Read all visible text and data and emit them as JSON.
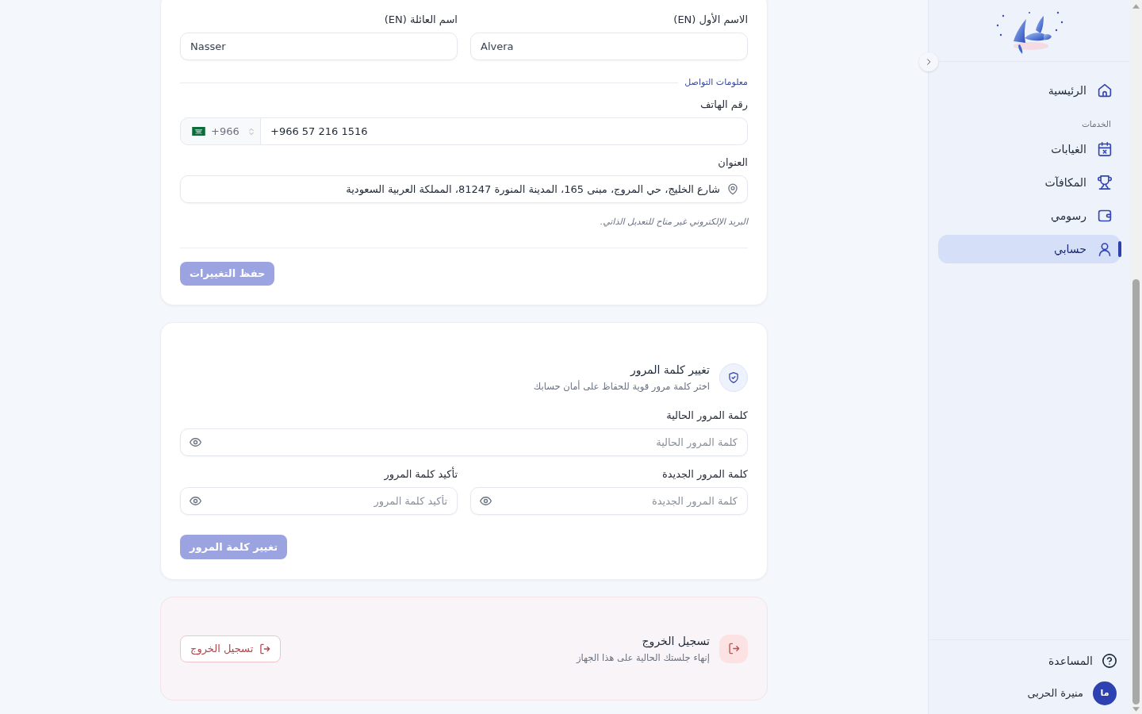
{
  "sidebar": {
    "main_items": [
      {
        "label": "الرئيسية",
        "selected": false
      }
    ],
    "services": {
      "heading": "الخدمات",
      "items": [
        {
          "label": "الغيابات",
          "selected": false
        },
        {
          "label": "المكافآت",
          "selected": false
        },
        {
          "label": "رسومي",
          "selected": false
        },
        {
          "label": "حسابي",
          "selected": true
        }
      ]
    },
    "help": {
      "label": "المساعدة"
    },
    "user": {
      "initials": "ما",
      "name": "منيرة الحربى"
    }
  },
  "profile_card": {
    "name_fields": [
      {
        "label": "الاسم الأول (EN)",
        "value": "Alvera"
      },
      {
        "label": "اسم العائلة (EN)",
        "value": "Nasser"
      }
    ],
    "contact_heading": "معلومات التواصل",
    "phone": {
      "label": "رقم الهاتف",
      "country_code": "+966",
      "value": "+966 57 216 1516"
    },
    "address": {
      "label": "العنوان",
      "value": "شارع الخليج، حي المروج، مبنى 165، المدينة المنورة 81247، المملكة العربية السعودية"
    },
    "note": "البريد الإلكتروني غير متاح للتعديل الذاتي.",
    "save_button": {
      "label": "حفظ التغييرات",
      "disabled": true
    }
  },
  "password_card": {
    "title": "تغيير كلمة المرور",
    "subtitle": "اختر كلمة مرور قوية للحفاظ على أمان حسابك",
    "fields": [
      {
        "label": "كلمة المرور الحالية",
        "placeholder": "كلمة المرور الحالية"
      },
      {
        "label": "كلمة المرور الجديدة",
        "placeholder": "كلمة المرور الجديدة"
      },
      {
        "label": "تأكيد كلمة المرور",
        "placeholder": "تأكيد كلمة المرور"
      }
    ],
    "submit_button": {
      "label": "تغيير كلمة المرور",
      "disabled": true
    }
  },
  "logout_card": {
    "title": "تسجيل الخروج",
    "subtitle": "إنهاء جلستك الحالية على هذا الجهاز",
    "button": {
      "label": "تسجيل الخروج"
    }
  }
}
